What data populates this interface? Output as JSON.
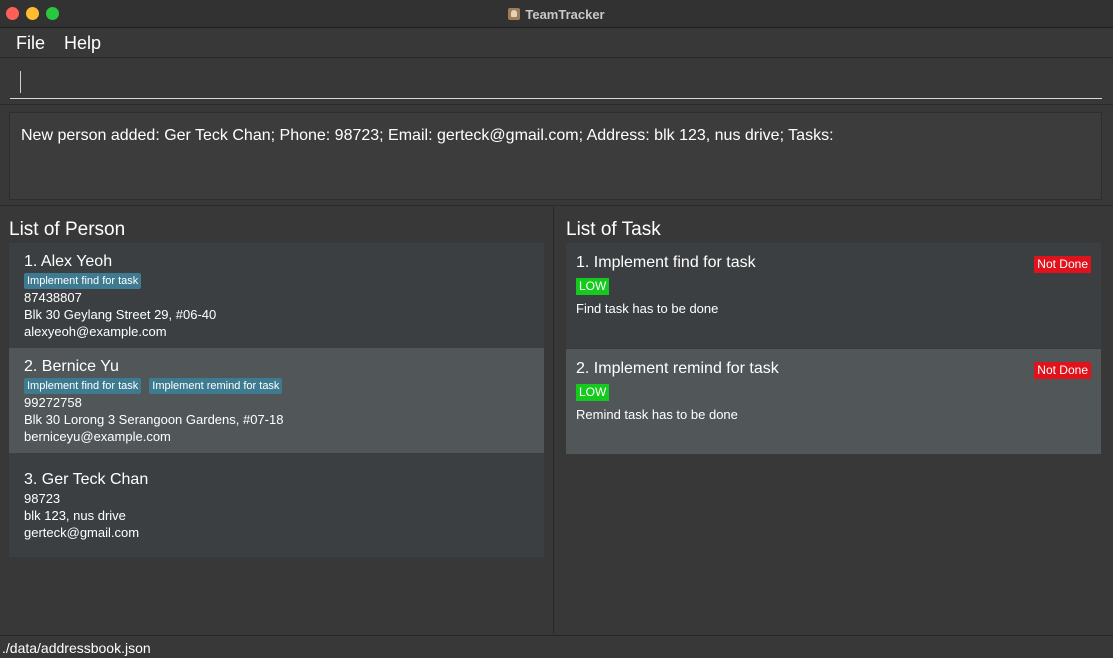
{
  "window": {
    "title": "TeamTracker"
  },
  "menu": {
    "file": "File",
    "help": "Help"
  },
  "command": {
    "value": ""
  },
  "result": {
    "text": "New person added: Ger Teck Chan; Phone: 98723; Email: gerteck@gmail.com; Address: blk 123, nus drive; Tasks:"
  },
  "persons": {
    "title": "List of Person",
    "items": [
      {
        "name": "1.  Alex Yeoh",
        "tags": [
          "Implement find for task"
        ],
        "phone": "87438807",
        "address": "Blk 30 Geylang Street 29, #06-40",
        "email": "alexyeoh@example.com"
      },
      {
        "name": "2.  Bernice Yu",
        "tags": [
          "Implement find for task",
          "Implement remind for task"
        ],
        "phone": "99272758",
        "address": "Blk 30 Lorong 3 Serangoon Gardens, #07-18",
        "email": "berniceyu@example.com"
      },
      {
        "name": "3.  Ger Teck Chan",
        "tags": [],
        "phone": "98723",
        "address": "blk 123, nus drive",
        "email": "gerteck@gmail.com"
      }
    ]
  },
  "tasks": {
    "title": "List of Task",
    "items": [
      {
        "title": "1. Implement find for task",
        "status": "Not Done",
        "priority": "LOW",
        "description": "Find task has to be done"
      },
      {
        "title": "2. Implement remind for task",
        "status": "Not Done",
        "priority": "LOW",
        "description": "Remind task has to be done"
      }
    ]
  },
  "statusbar": {
    "path": "./data/addressbook.json"
  },
  "colors": {
    "tag": "#3e7b91",
    "status_not_done": "#e0121c",
    "priority_low": "#15c91e",
    "close": "#fe5f57",
    "minimize": "#febc2e",
    "maximize": "#28c840"
  }
}
